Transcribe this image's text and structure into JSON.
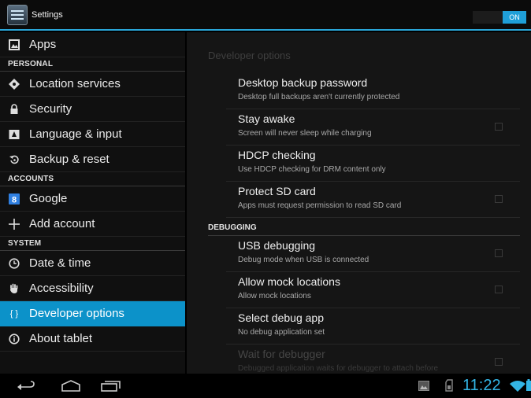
{
  "action_bar": {
    "title": "Settings",
    "toggle_label": "ON"
  },
  "sidebar": {
    "items": [
      {
        "label": "Apps",
        "icon": "apps-icon"
      },
      {
        "section": "PERSONAL"
      },
      {
        "label": "Location services",
        "icon": "location-icon"
      },
      {
        "label": "Security",
        "icon": "lock-icon"
      },
      {
        "label": "Language & input",
        "icon": "keyboard-icon"
      },
      {
        "label": "Backup & reset",
        "icon": "backup-icon"
      },
      {
        "section": "ACCOUNTS"
      },
      {
        "label": "Google",
        "icon": "google-icon"
      },
      {
        "label": "Add account",
        "icon": "plus-icon"
      },
      {
        "section": "SYSTEM"
      },
      {
        "label": "Date & time",
        "icon": "clock-icon"
      },
      {
        "label": "Accessibility",
        "icon": "hand-icon"
      },
      {
        "label": "Developer options",
        "icon": "braces-icon",
        "selected": true
      },
      {
        "label": "About tablet",
        "icon": "info-icon"
      }
    ]
  },
  "content": {
    "title": "Developer options",
    "debug_header": "DEBUGGING",
    "prefs": [
      {
        "title": "Desktop backup password",
        "summary": "Desktop full backups aren't currently protected",
        "checkbox": false
      },
      {
        "title": "Stay awake",
        "summary": "Screen will never sleep while charging",
        "checkbox": true,
        "checked": false
      },
      {
        "title": "HDCP checking",
        "summary": "Use HDCP checking for DRM content only",
        "checkbox": false
      },
      {
        "title": "Protect SD card",
        "summary": "Apps must request permission to read SD card",
        "checkbox": true,
        "checked": false
      },
      {
        "title": "USB debugging",
        "summary": "Debug mode when USB is connected",
        "checkbox": true,
        "checked": false
      },
      {
        "title": "Allow mock locations",
        "summary": "Allow mock locations",
        "checkbox": true,
        "checked": false
      },
      {
        "title": "Select debug app",
        "summary": "No debug application set",
        "checkbox": false
      },
      {
        "title": "Wait for debugger",
        "summary": "Debugged application waits for debugger to attach before",
        "checkbox": true,
        "checked": false,
        "disabled": true
      }
    ]
  },
  "system_bar": {
    "clock": "11:22"
  },
  "colors": {
    "accent": "#33b5e5",
    "selected": "#0c92c9"
  }
}
